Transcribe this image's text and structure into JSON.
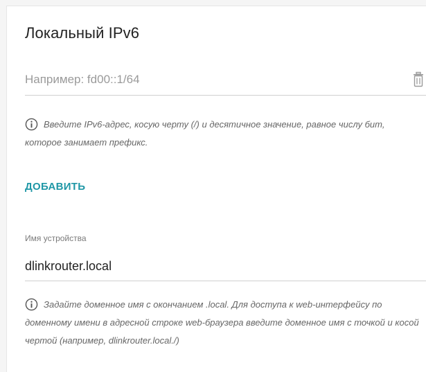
{
  "section": {
    "title": "Локальный IPv6"
  },
  "ipv6_field": {
    "value": "",
    "placeholder": "Например: fd00::1/64",
    "delete_icon": "trash-icon"
  },
  "ipv6_hint": {
    "icon": "info-circle-icon",
    "text": "Введите IPv6-адрес, косую черту (/) и десятичное значение, равное числу бит, которое занимает префикс."
  },
  "add_button": {
    "label": "ДОБАВИТЬ",
    "color": "#1f97a6"
  },
  "device_name": {
    "label": "Имя устройства",
    "value": "dlinkrouter.local"
  },
  "device_hint": {
    "icon": "info-circle-icon",
    "text": "Задайте доменное имя с окончанием .local. Для доступа к web-интерфейсу по доменному имени в адресной строке web-браузера введите доменное имя с точкой и косой чертой (например, dlinkrouter.local./)"
  }
}
